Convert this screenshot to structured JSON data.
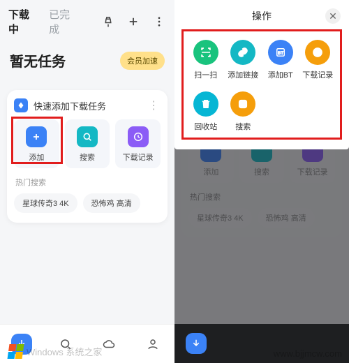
{
  "header": {
    "tabs": {
      "downloading": "下载中",
      "done": "已完成"
    },
    "icons": {
      "pin": "pin-icon",
      "plus": "plus-icon",
      "more": "more-icon"
    }
  },
  "empty_state": {
    "title": "暂无任务",
    "badge": "会员加速"
  },
  "quickcard": {
    "title": "快速添加下载任务",
    "tiles": {
      "add": "添加",
      "search": "搜索",
      "history": "下载记录"
    },
    "hot_label": "热门搜索",
    "hot_chips": [
      "星球传奇3 4K",
      "恐怖鸡 高清"
    ]
  },
  "sheet": {
    "title": "操作",
    "ops": [
      {
        "key": "scan",
        "label": "扫一扫",
        "color": "#19c37d"
      },
      {
        "key": "link",
        "label": "添加链接",
        "color": "#14b8c4"
      },
      {
        "key": "bt",
        "label": "添加BT",
        "color": "#3b82f6"
      },
      {
        "key": "history",
        "label": "下载记录",
        "color": "#f59e0b"
      },
      {
        "key": "trash",
        "label": "回收站",
        "color": "#06b6d4"
      },
      {
        "key": "search",
        "label": "搜索",
        "color": "#f59e0b"
      }
    ]
  },
  "bottomnav": [
    "home",
    "search",
    "cloud",
    "profile"
  ],
  "watermarks": {
    "left": "Windows 系统之家",
    "right": "www.bjjmcw.com"
  },
  "colors": {
    "accent": "#3b82f6",
    "highlight": "#e11d1d"
  }
}
